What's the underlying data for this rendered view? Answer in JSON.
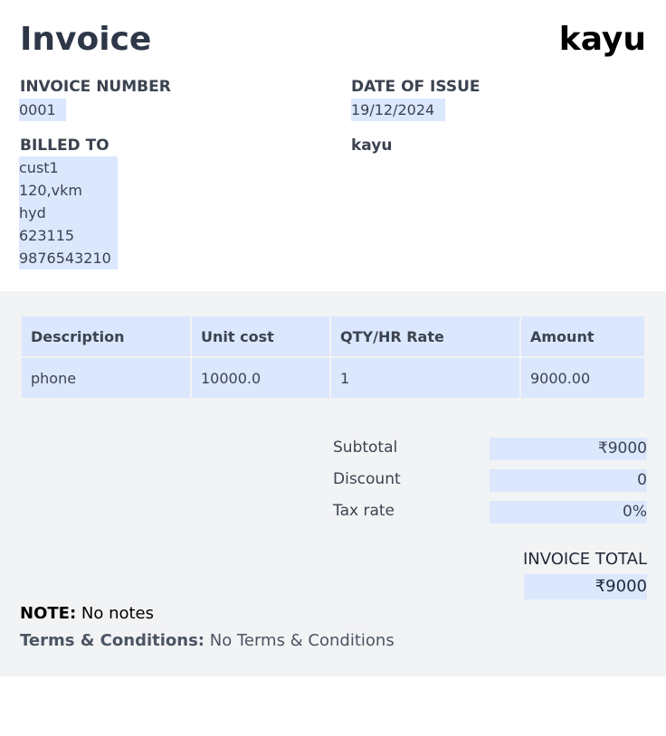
{
  "header": {
    "title": "Invoice",
    "brand": "kayu"
  },
  "invoice_number": {
    "label": "INVOICE NUMBER",
    "value": "0001"
  },
  "date_of_issue": {
    "label": "DATE OF ISSUE",
    "value": "19/12/2024"
  },
  "billed_to": {
    "label": "BILLED TO",
    "lines": [
      "cust1",
      "120,vkm",
      "hyd",
      "623115",
      "9876543210"
    ]
  },
  "from": {
    "name": "kayu"
  },
  "table": {
    "headers": [
      "Description",
      "Unit cost",
      "QTY/HR Rate",
      "Amount"
    ],
    "rows": [
      [
        "phone",
        "10000.0",
        "1",
        "9000.00"
      ]
    ]
  },
  "summary": {
    "subtotal_label": "Subtotal",
    "subtotal_value": "₹9000",
    "discount_label": "Discount",
    "discount_value": "0",
    "tax_label": "Tax rate",
    "tax_value": "0%"
  },
  "total": {
    "label": "INVOICE TOTAL",
    "value": "₹9000"
  },
  "note": {
    "label": "NOTE:",
    "value": "No notes"
  },
  "terms": {
    "label": "Terms & Conditions:",
    "value": "No Terms & Conditions"
  },
  "colors": {
    "field_bg": "#dbe7fd",
    "section_bg": "#f2f3f5",
    "text": "#2d3748"
  }
}
